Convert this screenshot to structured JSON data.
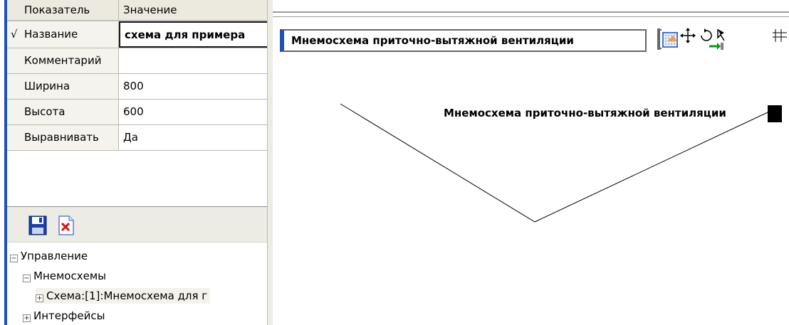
{
  "grid": {
    "header": {
      "name": "Показатель",
      "value": "Значение"
    },
    "rows": [
      {
        "name": "Название",
        "value": "схема для примера",
        "check": "√"
      },
      {
        "name": "Комментарий",
        "value": ""
      },
      {
        "name": "Ширина",
        "value": "800"
      },
      {
        "name": "Высота",
        "value": "600"
      },
      {
        "name": "Выравнивать",
        "value": "Да"
      }
    ]
  },
  "toolbar_left": {
    "save_icon": "floppy-disk-icon",
    "delete_icon": "red-x-document-icon"
  },
  "tree": {
    "root": {
      "label": "Управление",
      "expander": "−"
    },
    "mnemo": {
      "label": "Мнемосхемы",
      "expander": "−"
    },
    "scheme": {
      "label": "Схема:[1]:Мнемосхема для г",
      "expander": "+"
    },
    "interfaces": {
      "label": "Интерфейсы",
      "expander": "+"
    }
  },
  "editor": {
    "title_value": "Мнемосхема приточно-вытяжной вентиляции",
    "canvas_label": "Мнемосхема приточно-вытяжной вентиляции"
  },
  "colors": {
    "accent": "#1f4fb8",
    "panel": "#f4f3ee"
  }
}
